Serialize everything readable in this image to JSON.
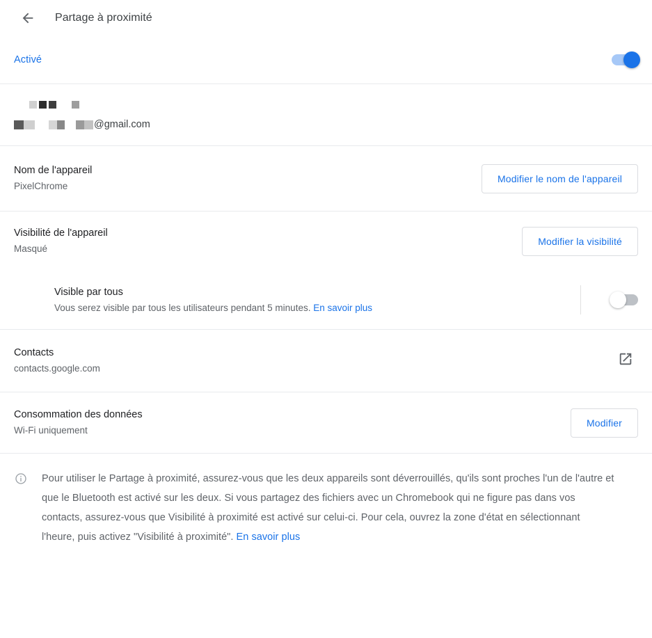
{
  "header": {
    "back_icon": "arrow-back-icon",
    "title": "Partage à proximité"
  },
  "enable": {
    "label": "Activé",
    "toggle_state": "on"
  },
  "account": {
    "name_redacted": true,
    "email_suffix": "@gmail.com"
  },
  "device_name": {
    "title": "Nom de l'appareil",
    "value": "PixelChrome",
    "button_label": "Modifier le nom de l'appareil"
  },
  "visibility": {
    "title": "Visibilité de l'appareil",
    "value": "Masqué",
    "button_label": "Modifier la visibilité"
  },
  "visible_to_all": {
    "title": "Visible par tous",
    "description": "Vous serez visible par tous les utilisateurs pendant 5 minutes.",
    "link_label": "En savoir plus",
    "toggle_state": "off"
  },
  "contacts": {
    "title": "Contacts",
    "value": "contacts.google.com",
    "icon": "open-in-new-icon"
  },
  "data_usage": {
    "title": "Consommation des données",
    "value": "Wi-Fi uniquement",
    "button_label": "Modifier"
  },
  "footnote": {
    "icon": "info-icon",
    "text": "Pour utiliser le Partage à proximité, assurez-vous que les deux appareils sont déverrouillés, qu'ils sont proches l'un de l'autre et que le Bluetooth est activé sur les deux. Si vous partagez des fichiers avec un Chromebook qui ne figure pas dans vos contacts, assurez-vous que Visibilité à proximité est activé sur celui-ci. Pour cela, ouvrez la zone d'état en sélectionnant l'heure, puis activez \"Visibilité à proximité\". ",
    "link_label": "En savoir plus"
  },
  "colors": {
    "accent_blue": "#1a73e8",
    "toggle_on_track": "#a6c8f7",
    "toggle_off_track": "#bdc1c6",
    "primary_text": "#202124",
    "secondary_text": "#5f6368",
    "divider": "#e8eaed",
    "border": "#dadce0"
  }
}
